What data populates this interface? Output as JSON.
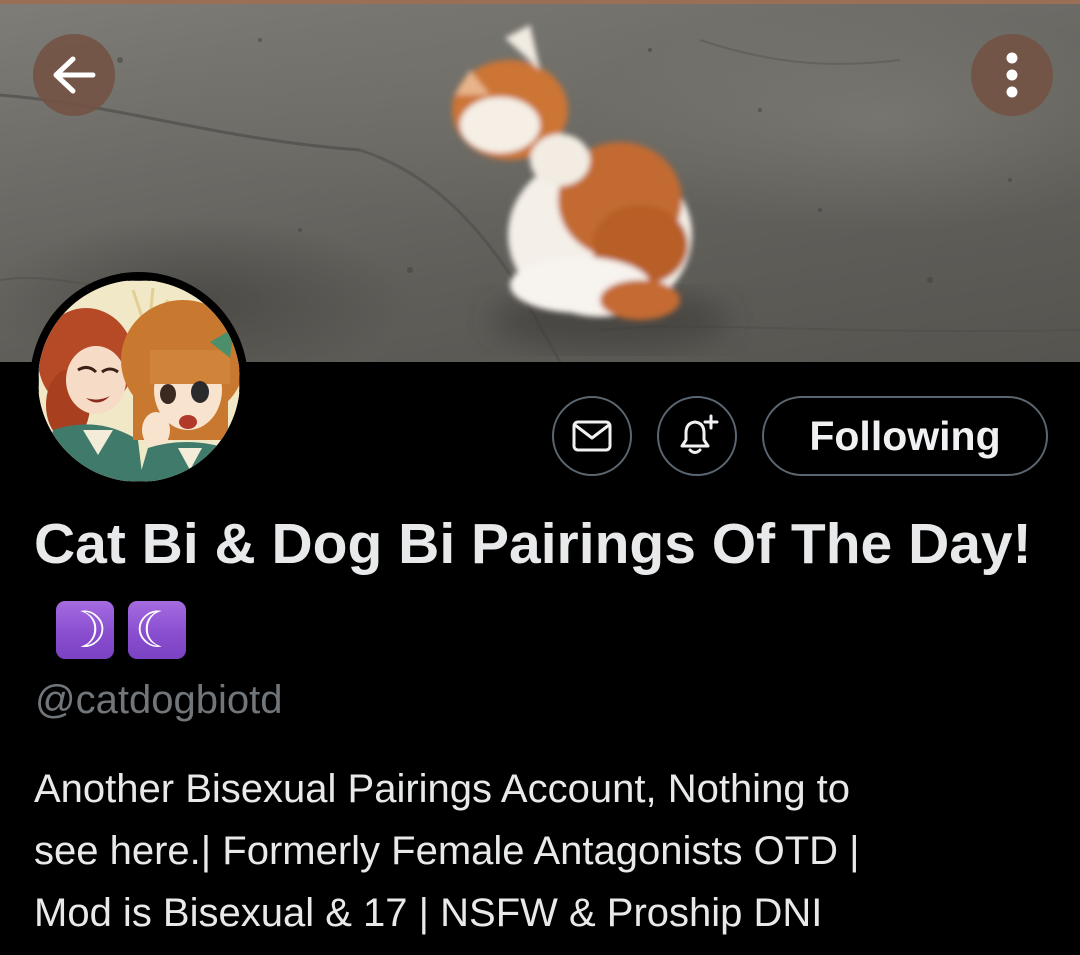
{
  "header": {
    "back_icon": "arrow-left-icon",
    "more_icon": "more-vertical-icon",
    "banner_image": "orange-and-white-kitten-on-pavement"
  },
  "profile": {
    "avatar_image": "two-anime-girls-whispering",
    "display_name": "Cat Bi & Dog Bi Pairings Of The Day!",
    "name_emojis": [
      "☽",
      "☾"
    ],
    "handle": "@catdogbiotd",
    "bio_lines": [
      "Another Bisexual Pairings Account, Nothing to",
      "see here.| Formerly Female Antagonists OTD |",
      "Mod is Bisexual & 17 | NSFW & Proship DNI"
    ]
  },
  "actions": {
    "message_icon": "mail-icon",
    "notify_icon": "bell-plus-icon",
    "following_label": "Following"
  },
  "colors": {
    "background": "#000000",
    "text_primary": "#e7e9ea",
    "text_secondary": "#71767b",
    "button_border": "#5c6670",
    "emoji_purple": "#8a4fd0",
    "nav_button_bg": "#735242"
  }
}
